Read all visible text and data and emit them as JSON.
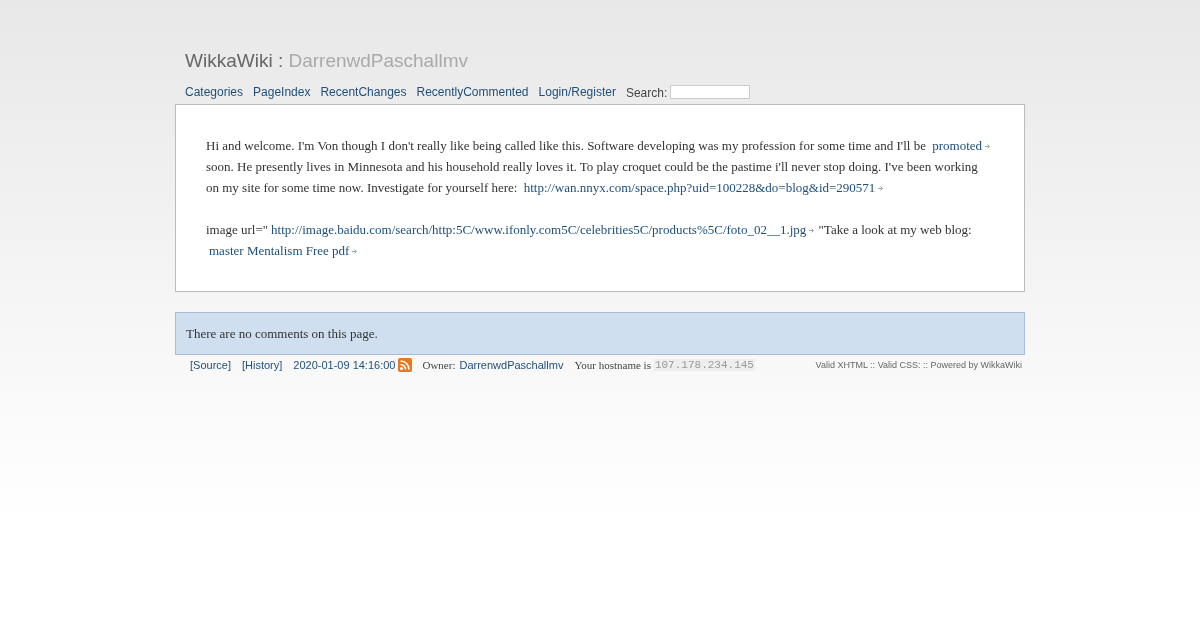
{
  "header": {
    "site": "WikkaWiki",
    "separator": ":",
    "page": "DarrenwdPaschallmv"
  },
  "nav": {
    "links": [
      "Categories",
      "PageIndex",
      "RecentChanges",
      "RecentlyCommented",
      "Login/Register"
    ],
    "search_label": "Search:"
  },
  "content": {
    "paragraphs": [
      [
        {
          "kind": "text",
          "text": "Hi and welcome. I'm Von though I don't really like being called like this. Software developing was my profession for some time and I'll be "
        },
        {
          "kind": "extlink",
          "text": "promoted"
        },
        {
          "kind": "text",
          "text": " soon. He presently lives in Minnesota and his household really loves it. To play croquet could be the pastime i'll never stop doing. I've been working on my site for some time now. Investigate for yourself here: "
        },
        {
          "kind": "extlink",
          "text": "http://wan.nnyx.com/space.php?uid=100228&do=blog&id=290571"
        }
      ],
      [
        {
          "kind": "text",
          "text": "image url=\""
        },
        {
          "kind": "extlink",
          "text": "http://image.baidu.com/search/http:5C/www.ifonly.com5C/celebrities5C/products%5C/foto_02__1.jpg"
        },
        {
          "kind": "text",
          "text": " \"Take a look at my web blog: "
        },
        {
          "kind": "extlink",
          "text": "master Mentalism Free pdf"
        }
      ]
    ]
  },
  "comments": {
    "message": "There are no comments on this page."
  },
  "footer": {
    "source": "[Source]",
    "history": "[History]",
    "date": "2020-01-09 14:16:00",
    "owner_label": "Owner:",
    "owner": "DarrenwdPaschallmv",
    "hostname_label": "Your hostname is",
    "hostname": "107.178.234.145",
    "credits": "Valid XHTML :: Valid CSS: :: Powered by WikkaWiki"
  }
}
